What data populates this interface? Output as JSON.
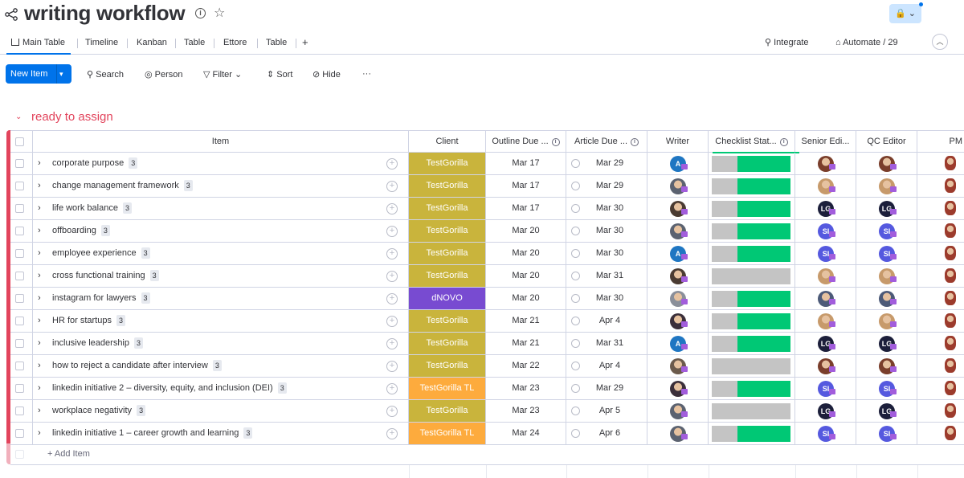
{
  "board": {
    "title": "writing workflow",
    "lock_label": "🔒 ⌄"
  },
  "tabs": [
    {
      "label": "Main Table"
    },
    {
      "label": "Timeline"
    },
    {
      "label": "Kanban"
    },
    {
      "label": "Table"
    },
    {
      "label": "Ettore"
    },
    {
      "label": "Table"
    },
    {
      "label": "+"
    }
  ],
  "header_tools": {
    "integrate": "Integrate",
    "automate": "Automate / 29"
  },
  "toolbar": {
    "new_item": "New Item",
    "search": "Search",
    "person": "Person",
    "filter": "Filter",
    "sort": "Sort",
    "hide": "Hide",
    "more": "···"
  },
  "group": {
    "title": "ready to assign",
    "add_item": "+ Add Item"
  },
  "columns": {
    "item": "Item",
    "client": "Client",
    "outline_due": "Outline Due ...",
    "article_due": "Article Due ...",
    "writer": "Writer",
    "checklist": "Checklist Stat...",
    "senior_editor": "Senior Edi...",
    "qc_editor": "QC Editor",
    "pm": "PM"
  },
  "colors": {
    "accent": "#0073ea",
    "group": "#e2445c",
    "done": "#00c875",
    "testgorilla": "#c4b43c",
    "testgorilla_tl": "#fdab3d",
    "dnovo": "#784bd1"
  },
  "rows": [
    {
      "name": "corporate purpose",
      "count": "3",
      "client": "TestGorilla",
      "client_color": "#c9b43c",
      "outline": "Mar 17",
      "article": "Mar 29",
      "writer": {
        "type": "letter",
        "text": "A",
        "color": "#1f76c2"
      },
      "checklist_done": 0.67,
      "senior": {
        "type": "photo",
        "text": "",
        "color": "#7a3e2b"
      },
      "qc": {
        "type": "photo",
        "text": "",
        "color": "#7a3e2b"
      }
    },
    {
      "name": "change management framework",
      "count": "3",
      "client": "TestGorilla",
      "client_color": "#c9b43c",
      "outline": "Mar 17",
      "article": "Mar 29",
      "writer": {
        "type": "photo",
        "text": "",
        "color": "#5b6270"
      },
      "checklist_done": 0.67,
      "senior": {
        "type": "photo",
        "text": "",
        "color": "#c79a6b"
      },
      "qc": {
        "type": "photo",
        "text": "",
        "color": "#c79a6b"
      }
    },
    {
      "name": "life work balance",
      "count": "3",
      "client": "TestGorilla",
      "client_color": "#c9b43c",
      "outline": "Mar 17",
      "article": "Mar 30",
      "writer": {
        "type": "photo",
        "text": "",
        "color": "#4a3b32"
      },
      "checklist_done": 0.67,
      "senior": {
        "type": "letter",
        "text": "LG",
        "color": "#1c1f3b"
      },
      "qc": {
        "type": "letter",
        "text": "LG",
        "color": "#1c1f3b"
      }
    },
    {
      "name": "offboarding",
      "count": "3",
      "client": "TestGorilla",
      "client_color": "#c9b43c",
      "outline": "Mar 20",
      "article": "Mar 30",
      "writer": {
        "type": "photo",
        "text": "",
        "color": "#5b6270"
      },
      "checklist_done": 0.67,
      "senior": {
        "type": "letter",
        "text": "SI",
        "color": "#5559df"
      },
      "qc": {
        "type": "letter",
        "text": "SI",
        "color": "#5559df"
      }
    },
    {
      "name": "employee experience",
      "count": "3",
      "client": "TestGorilla",
      "client_color": "#c9b43c",
      "outline": "Mar 20",
      "article": "Mar 30",
      "writer": {
        "type": "letter",
        "text": "A",
        "color": "#1f76c2"
      },
      "checklist_done": 0.67,
      "senior": {
        "type": "letter",
        "text": "SI",
        "color": "#5559df"
      },
      "qc": {
        "type": "letter",
        "text": "SI",
        "color": "#5559df"
      }
    },
    {
      "name": "cross functional training",
      "count": "3",
      "client": "TestGorilla",
      "client_color": "#c9b43c",
      "outline": "Mar 20",
      "article": "Mar 31",
      "writer": {
        "type": "photo",
        "text": "",
        "color": "#4a3b32"
      },
      "checklist_done": 0,
      "senior": {
        "type": "photo",
        "text": "",
        "color": "#c79a6b"
      },
      "qc": {
        "type": "photo",
        "text": "",
        "color": "#c79a6b"
      }
    },
    {
      "name": "instagram for lawyers",
      "count": "3",
      "client": "dNOVO",
      "client_color": "#784bd1",
      "outline": "Mar 20",
      "article": "Mar 30",
      "writer": {
        "type": "photo",
        "text": "",
        "color": "#8a8f9a"
      },
      "checklist_done": 0.67,
      "senior": {
        "type": "photo",
        "text": "",
        "color": "#4c5a78"
      },
      "qc": {
        "type": "photo",
        "text": "",
        "color": "#4c5a78"
      }
    },
    {
      "name": "HR for startups",
      "count": "3",
      "client": "TestGorilla",
      "client_color": "#c9b43c",
      "outline": "Mar 21",
      "article": "Apr 4",
      "writer": {
        "type": "photo",
        "text": "",
        "color": "#3b2f3a"
      },
      "checklist_done": 0.67,
      "senior": {
        "type": "photo",
        "text": "",
        "color": "#c79a6b"
      },
      "qc": {
        "type": "photo",
        "text": "",
        "color": "#c79a6b"
      }
    },
    {
      "name": "inclusive leadership",
      "count": "3",
      "client": "TestGorilla",
      "client_color": "#c9b43c",
      "outline": "Mar 21",
      "article": "Mar 31",
      "writer": {
        "type": "letter",
        "text": "A",
        "color": "#1f76c2"
      },
      "checklist_done": 0.67,
      "senior": {
        "type": "letter",
        "text": "LG",
        "color": "#1c1f3b"
      },
      "qc": {
        "type": "letter",
        "text": "LG",
        "color": "#1c1f3b"
      }
    },
    {
      "name": "how to reject a candidate after interview",
      "count": "3",
      "client": "TestGorilla",
      "client_color": "#c9b43c",
      "outline": "Mar 22",
      "article": "Apr 4",
      "writer": {
        "type": "photo",
        "text": "",
        "color": "#6b5a4c"
      },
      "checklist_done": 0,
      "senior": {
        "type": "photo",
        "text": "",
        "color": "#7a3e2b"
      },
      "qc": {
        "type": "photo",
        "text": "",
        "color": "#7a3e2b"
      }
    },
    {
      "name": "linkedin initiative 2 – diversity, equity, and inclusion (DEI)",
      "count": "3",
      "client": "TestGorilla TL",
      "client_color": "#fdab3d",
      "outline": "Mar 23",
      "article": "Mar 29",
      "writer": {
        "type": "photo",
        "text": "",
        "color": "#3b2f3a"
      },
      "checklist_done": 0.67,
      "senior": {
        "type": "letter",
        "text": "SI",
        "color": "#5559df"
      },
      "qc": {
        "type": "letter",
        "text": "SI",
        "color": "#5559df"
      }
    },
    {
      "name": "workplace negativity",
      "count": "3",
      "client": "TestGorilla",
      "client_color": "#c9b43c",
      "outline": "Mar 23",
      "article": "Apr 5",
      "writer": {
        "type": "photo",
        "text": "",
        "color": "#5b6270"
      },
      "checklist_done": 0,
      "senior": {
        "type": "letter",
        "text": "LG",
        "color": "#1c1f3b"
      },
      "qc": {
        "type": "letter",
        "text": "LG",
        "color": "#1c1f3b"
      }
    },
    {
      "name": "linkedin initiative 1 – career growth and learning",
      "count": "3",
      "client": "TestGorilla TL",
      "client_color": "#fdab3d",
      "outline": "Mar 24",
      "article": "Apr 6",
      "writer": {
        "type": "photo",
        "text": "",
        "color": "#5b6270"
      },
      "checklist_done": 0.67,
      "senior": {
        "type": "letter",
        "text": "SI",
        "color": "#5559df"
      },
      "qc": {
        "type": "letter",
        "text": "SI",
        "color": "#5559df"
      }
    }
  ]
}
